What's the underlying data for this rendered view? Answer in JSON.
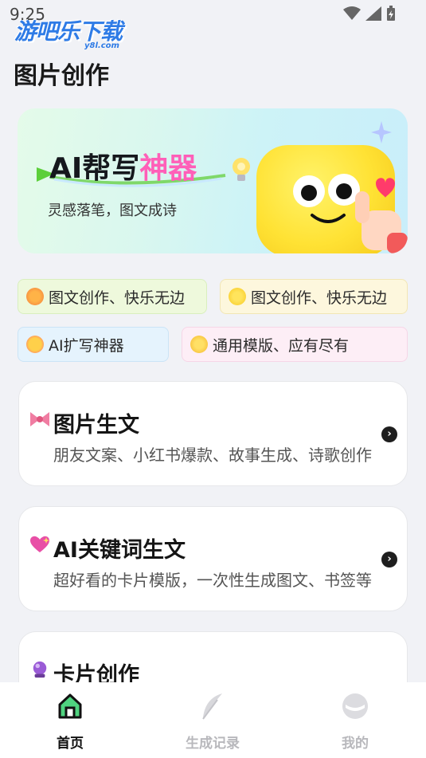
{
  "status_bar": {
    "time": "9:25"
  },
  "watermark": {
    "brand": "游吧乐下载",
    "domain": "y8l.com"
  },
  "page": {
    "title": "图片创作"
  },
  "banner": {
    "title_part1": "AI帮写",
    "title_part2": "神器",
    "subtitle": "灵感落笔，图文成诗"
  },
  "chips": [
    {
      "label": "图文创作、快乐无边",
      "icon": "cocktail-icon"
    },
    {
      "label": "图文创作、快乐无边",
      "icon": "sparkles-icon"
    },
    {
      "label": "AI扩写神器",
      "icon": "smiling-face-with-hearts-icon"
    },
    {
      "label": "通用模版、应有尽有",
      "icon": "dizzy-icon"
    }
  ],
  "cards": [
    {
      "title": "图片生文",
      "description": "朋友文案、小红书爆款、故事生成、诗歌创作",
      "icon": "ribbon-icon"
    },
    {
      "title": "AI关键词生文",
      "description": "超好看的卡片模版，一次性生成图文、书签等",
      "icon": "sparkling-heart-icon"
    },
    {
      "title": "卡片创作",
      "description": "",
      "icon": "crystal-ball-icon"
    }
  ],
  "tab_bar": {
    "items": [
      {
        "label": "首页",
        "icon": "home-icon",
        "active": true
      },
      {
        "label": "生成记录",
        "icon": "feather-icon",
        "active": false
      },
      {
        "label": "我的",
        "icon": "profile-face-icon",
        "active": false
      }
    ]
  },
  "colors": {
    "accent_pink": "#ff5fb8",
    "home_green": "#4fd37f",
    "background": "#f1f2f6"
  }
}
